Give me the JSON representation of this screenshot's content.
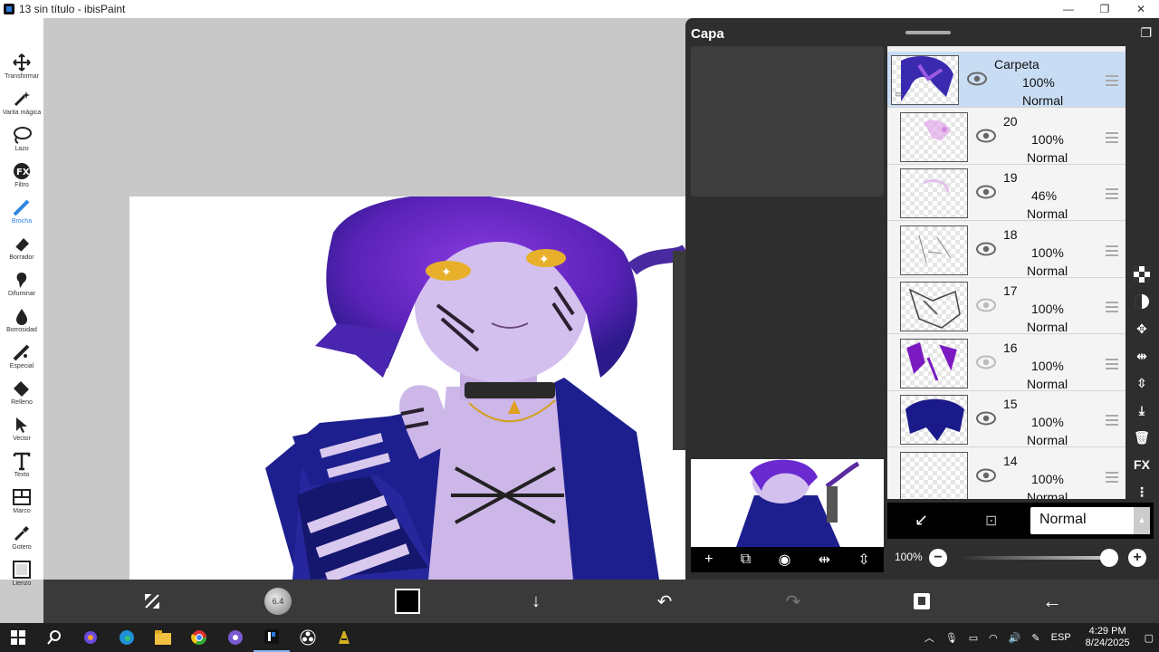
{
  "window": {
    "title": "13 sin título - ibisPaint",
    "minimize": "—",
    "maximize": "❐",
    "close": "✕"
  },
  "tools": [
    {
      "label": "Transformar",
      "icon": "move-icon"
    },
    {
      "label": "Varita mágica",
      "icon": "magic-wand-icon"
    },
    {
      "label": "Lazo",
      "icon": "lasso-icon"
    },
    {
      "label": "Filtro",
      "icon": "fx-icon"
    },
    {
      "label": "Brocha",
      "icon": "brush-icon",
      "active": true
    },
    {
      "label": "Borrador",
      "icon": "eraser-icon"
    },
    {
      "label": "Difuminar",
      "icon": "smudge-icon"
    },
    {
      "label": "Borrosidad",
      "icon": "blur-drop-icon"
    },
    {
      "label": "Especial",
      "icon": "special-pen-icon"
    },
    {
      "label": "Relleno",
      "icon": "fill-icon"
    },
    {
      "label": "Vector",
      "icon": "vector-cursor-icon"
    },
    {
      "label": "Texto",
      "icon": "text-icon"
    },
    {
      "label": "Marco",
      "icon": "frame-icon"
    },
    {
      "label": "Gotero",
      "icon": "eyedropper-icon"
    },
    {
      "label": "Lienzo",
      "icon": "canvas-icon"
    }
  ],
  "layer_panel": {
    "title": "Capa",
    "layers": [
      {
        "name": "Carpeta",
        "opacity": "100%",
        "blend": "Normal",
        "selected": true,
        "folder": true,
        "visible": true
      },
      {
        "name": "20",
        "opacity": "100%",
        "blend": "Normal",
        "visible": true
      },
      {
        "name": "19",
        "opacity": "46%",
        "blend": "Normal",
        "visible": true
      },
      {
        "name": "18",
        "opacity": "100%",
        "blend": "Normal",
        "visible": true
      },
      {
        "name": "17",
        "opacity": "100%",
        "blend": "Normal",
        "visible": false
      },
      {
        "name": "16",
        "opacity": "100%",
        "blend": "Normal",
        "visible": false
      },
      {
        "name": "15",
        "opacity": "100%",
        "blend": "Normal",
        "visible": true
      },
      {
        "name": "14",
        "opacity": "100%",
        "blend": "Normal",
        "visible": true
      }
    ],
    "blend_mode": "Normal",
    "opacity_label": "100%",
    "opacity_value": 1.0,
    "minus": "−",
    "plus": "+",
    "fx_label": "FX"
  },
  "bottom_toolbar": {
    "brush_size": "6.4",
    "primary_color": "#000000"
  },
  "taskbar": {
    "language": "ESP",
    "time": "4:29 PM",
    "date": "8/24/2025"
  }
}
